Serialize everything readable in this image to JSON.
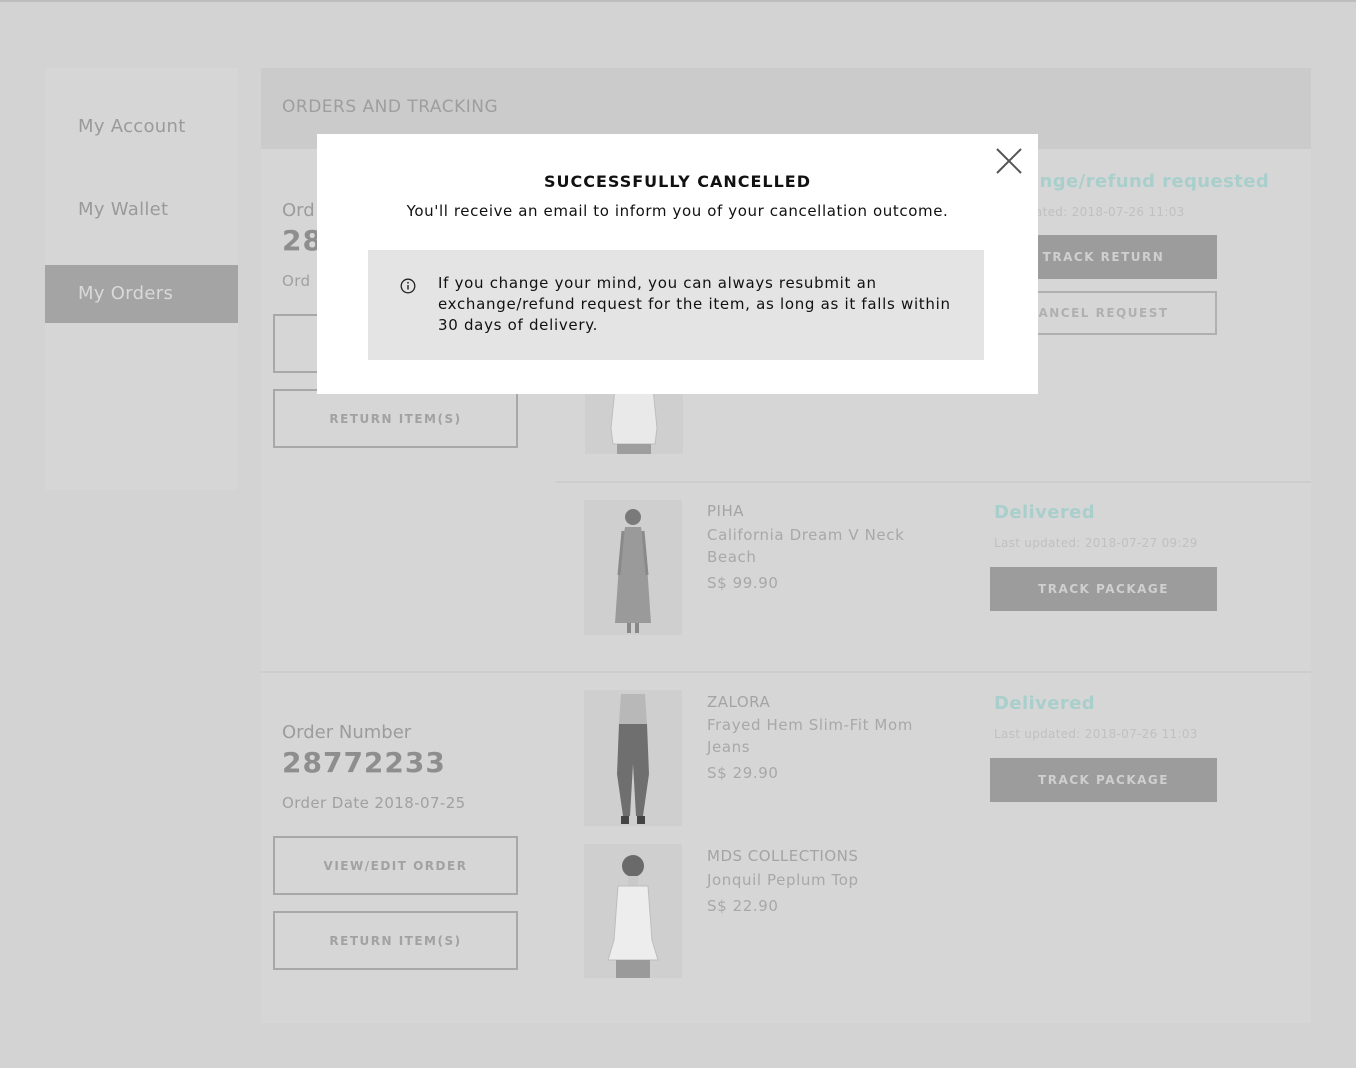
{
  "sidebar": {
    "items": [
      {
        "label": "My Account"
      },
      {
        "label": "My Wallet"
      },
      {
        "label": "My Orders"
      }
    ]
  },
  "main": {
    "title": "ORDERS AND TRACKING",
    "orders": [
      {
        "label": "Ord",
        "number": "28",
        "date": "Ord",
        "return_label": "RETURN ITEM(S)",
        "items": [
          {
            "status": "ange/refund requested",
            "updated": "dated: 2018-07-26 11:03",
            "primary_button": "TRACK RETURN",
            "secondary_button": "ANCEL REQUEST"
          },
          {
            "brand": "PIHA",
            "name": "California Dream V Neck Beach",
            "price": "S$ 99.90",
            "status": "Delivered",
            "updated": "Last updated: 2018-07-27 09:29",
            "button": "TRACK PACKAGE"
          }
        ]
      },
      {
        "label": "Order Number",
        "number": "28772233",
        "date": "Order Date 2018-07-25",
        "view_label": "VIEW/EDIT ORDER",
        "return_label": "RETURN ITEM(S)",
        "items": [
          {
            "brand": "ZALORA",
            "name": "Frayed Hem Slim-Fit Mom Jeans",
            "price": "S$ 29.90",
            "status": "Delivered",
            "updated": "Last updated: 2018-07-26 11:03",
            "button": "TRACK PACKAGE"
          },
          {
            "brand": "MDS COLLECTIONS",
            "name": "Jonquil Peplum Top",
            "price": "S$ 22.90"
          }
        ]
      }
    ]
  },
  "modal": {
    "title": "SUCCESSFULLY CANCELLED",
    "subtitle": "You'll receive an email to inform you of your cancellation outcome.",
    "note": "If you change your mind, you can always resubmit an exchange/refund request for the item, as long as it falls within 30 days of delivery.",
    "close_icon": "close-icon",
    "info_icon": "info-icon"
  },
  "colors": {
    "overlay_bg": "#d3d3d3",
    "status_teal": "#a9cfcc",
    "active_nav": "#a4a4a4",
    "modal_bg": "#ffffff",
    "note_bg": "#e4e4e4"
  }
}
